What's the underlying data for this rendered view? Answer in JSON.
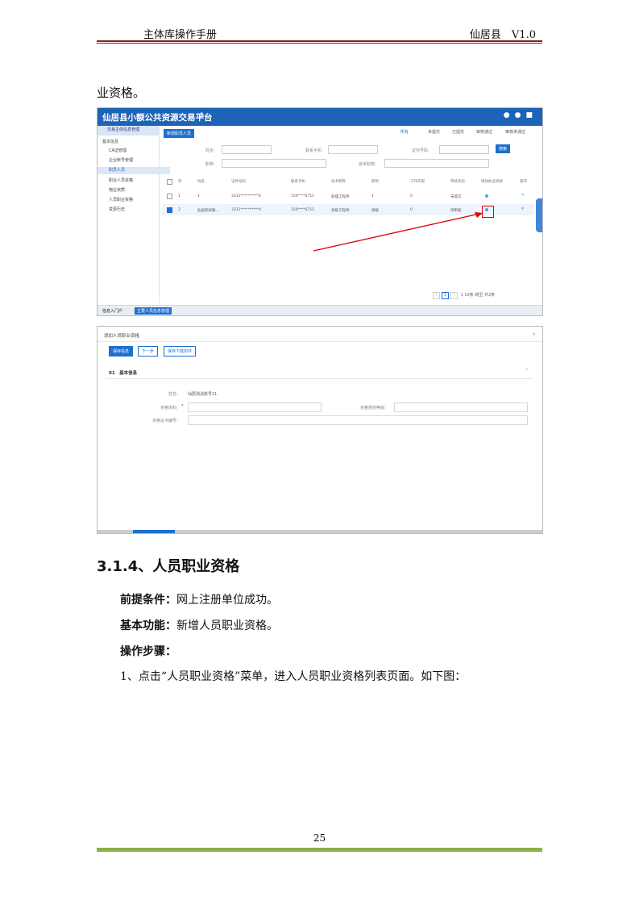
{
  "header": {
    "left": "主体库操作手册",
    "right": "仙居县　V1.0"
  },
  "intro_text": "业资格。",
  "shot1": {
    "title": "仙居县小额公共资源交易平台",
    "side_head": "交易主体信息管理",
    "nav": [
      "基本信息",
      "CA证管理",
      "企业账号管理",
      "职员人员",
      "职业人员资格",
      "物业资质",
      "人员职业资格",
      "变更历史"
    ],
    "add_button": "新增职员人员",
    "radios": [
      "所有",
      "未提交",
      "已提交",
      "审核通过",
      "审核未通过"
    ],
    "filters": {
      "name": "姓名:",
      "phone": "联系手机:",
      "cert_no": "证件号码:",
      "title": "职称:",
      "job": "技术职称:",
      "search": "搜索"
    },
    "columns": [
      "序",
      "姓名",
      "证件号码",
      "联系手机",
      "技术职称",
      "职称",
      "工作年限",
      "审核状态",
      "增加执业资格",
      "操作"
    ],
    "rows": [
      {
        "no": "1",
        "name": "1",
        "id": "3312**********6",
        "phone": "150****6711",
        "job": "助理工程师",
        "title": "初级",
        "years": "1",
        "count": "0",
        "status": "未提交",
        "checked": false
      },
      {
        "no": "2",
        "name": "仙居测试账…",
        "id": "3312**********X",
        "phone": "150****6711",
        "job": "高级工程师",
        "title": "高级",
        "years": "0",
        "count": "0",
        "status": "待审核",
        "checked": true
      }
    ],
    "pager": {
      "current": "1",
      "total": "1",
      "per": "10条",
      "jump": "跳至",
      "page": "页",
      "total_label": "共2条"
    },
    "tabs": [
      "信息入门户",
      "主要人员信息管理"
    ]
  },
  "shot2": {
    "title": "添加人员职业资格",
    "buttons": [
      "保存信息",
      "下一步",
      "保存下载附件"
    ],
    "section": "01　基本信息",
    "fields": {
      "name_label": "姓名:",
      "name_value": "仙居测试账号11",
      "qual_label": "资格资料:",
      "qual_type_label": "资格类别等级:",
      "cert_label": "资格证书编号:",
      "required": "*"
    }
  },
  "section_heading": "3.1.4、人员职业资格",
  "paragraphs": [
    {
      "label": "前提条件：",
      "text": "网上注册单位成功。"
    },
    {
      "label": "基本功能：",
      "text": "新增人员职业资格。"
    },
    {
      "label": "操作步骤：",
      "text": ""
    },
    {
      "label": "",
      "text": "1、点击“人员职业资格”菜单，进入人员职业资格列表页面。如下图："
    }
  ],
  "page_number": "25",
  "colors": {
    "header_line": "#8a2020",
    "footer_line": "#8db04a",
    "app_blue": "#1d63b7",
    "callout_red": "#dd0000"
  }
}
